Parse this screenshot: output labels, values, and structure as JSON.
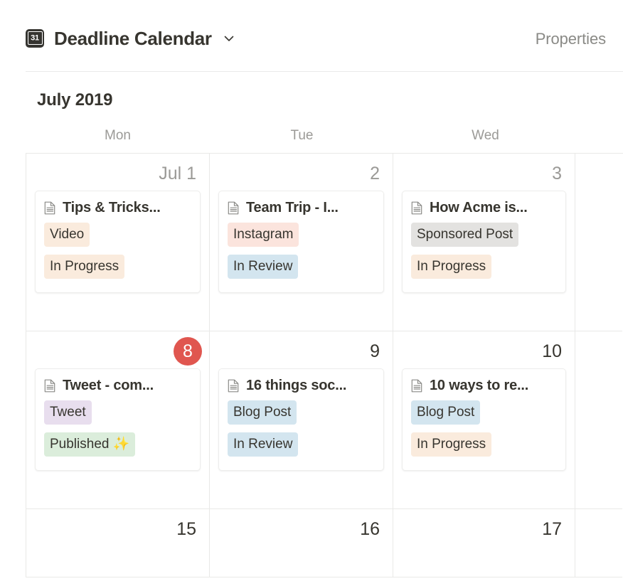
{
  "header": {
    "icon": "calendar-31-icon",
    "icon_day": "31",
    "title": "Deadline Calendar",
    "chevron": "chevron-down-icon",
    "properties_label": "Properties"
  },
  "calendar": {
    "month_label": "July 2019",
    "weekdays": [
      "Mon",
      "Tue",
      "Wed"
    ],
    "colors": {
      "today_badge": "#e0564f",
      "tag_cream": "#faebdd",
      "tag_peach": "#fbe4dd",
      "tag_blue": "#d3e5ef",
      "tag_gray": "#e3e2e0",
      "tag_purple": "#e8deee",
      "tag_green": "#dbeddb",
      "grid_line": "#e9e9e7",
      "muted_text": "#9b9a97"
    },
    "rows": [
      {
        "cells": [
          {
            "day": "Jul 1",
            "day_style": "muted",
            "event": {
              "icon": "document-icon",
              "title": "Tips & Tricks...",
              "tags": [
                {
                  "label": "Video",
                  "color": "cream"
                },
                {
                  "label": "In Progress",
                  "color": "cream"
                }
              ]
            }
          },
          {
            "day": "2",
            "day_style": "muted",
            "event": {
              "icon": "document-icon",
              "title": "Team Trip - I...",
              "tags": [
                {
                  "label": "Instagram",
                  "color": "peach"
                },
                {
                  "label": "In Review",
                  "color": "blue"
                }
              ]
            }
          },
          {
            "day": "3",
            "day_style": "muted",
            "event": {
              "icon": "document-icon",
              "title": "How Acme is...",
              "tags": [
                {
                  "label": "Sponsored Post",
                  "color": "gray"
                },
                {
                  "label": "In Progress",
                  "color": "cream"
                }
              ]
            }
          },
          {
            "day": "",
            "day_style": "muted",
            "event": null
          }
        ]
      },
      {
        "cells": [
          {
            "day": "8",
            "day_style": "today",
            "event": {
              "icon": "document-icon",
              "title": "Tweet - com...",
              "tags": [
                {
                  "label": "Tweet",
                  "color": "purple"
                },
                {
                  "label": "Published ✨",
                  "color": "green"
                }
              ]
            }
          },
          {
            "day": "9",
            "day_style": "dark",
            "event": {
              "icon": "document-icon",
              "title": "16 things soc...",
              "tags": [
                {
                  "label": "Blog Post",
                  "color": "blue"
                },
                {
                  "label": "In Review",
                  "color": "blue"
                }
              ]
            }
          },
          {
            "day": "10",
            "day_style": "dark",
            "event": {
              "icon": "document-icon",
              "title": "10 ways to re...",
              "tags": [
                {
                  "label": "Blog Post",
                  "color": "blue"
                },
                {
                  "label": "In Progress",
                  "color": "cream"
                }
              ]
            }
          },
          {
            "day": "",
            "day_style": "muted",
            "event": null
          }
        ]
      },
      {
        "short": true,
        "cells": [
          {
            "day": "15",
            "day_style": "dark",
            "event": null
          },
          {
            "day": "16",
            "day_style": "dark",
            "event": null
          },
          {
            "day": "17",
            "day_style": "dark",
            "event": null
          },
          {
            "day": "",
            "day_style": "muted",
            "event": null
          }
        ]
      }
    ]
  }
}
